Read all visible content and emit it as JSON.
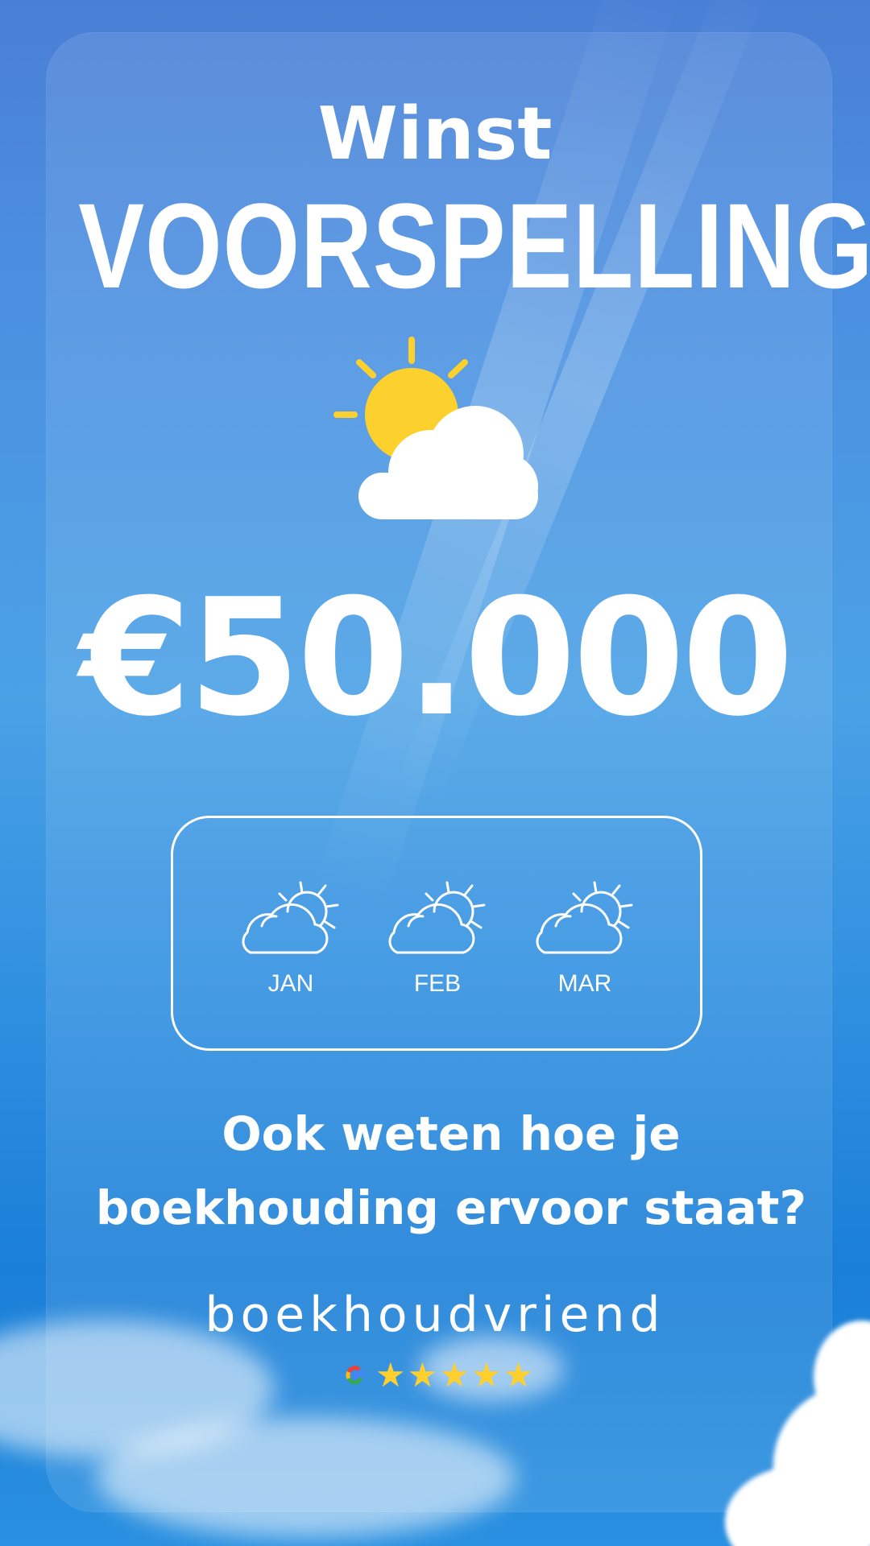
{
  "header": {
    "title_small": "Winst",
    "title_big": "VOORSPELLING"
  },
  "forecast": {
    "amount": "€50.000",
    "icon": "sun-behind-cloud-icon"
  },
  "months": [
    {
      "label": "JAN",
      "icon": "partly-cloudy-icon"
    },
    {
      "label": "FEB",
      "icon": "partly-cloudy-icon"
    },
    {
      "label": "MAR",
      "icon": "partly-cloudy-icon"
    }
  ],
  "question": {
    "line1": "Ook weten hoe je",
    "line2": "boekhouding ervoor staat?"
  },
  "brand": {
    "name": "boekhoudvriend"
  },
  "rating": {
    "source_icon": "google-icon",
    "stars": 5
  },
  "colors": {
    "sun": "#fdd12d",
    "star": "#ffcf2e",
    "text": "#ffffff",
    "sky": "#4aa1e6"
  }
}
